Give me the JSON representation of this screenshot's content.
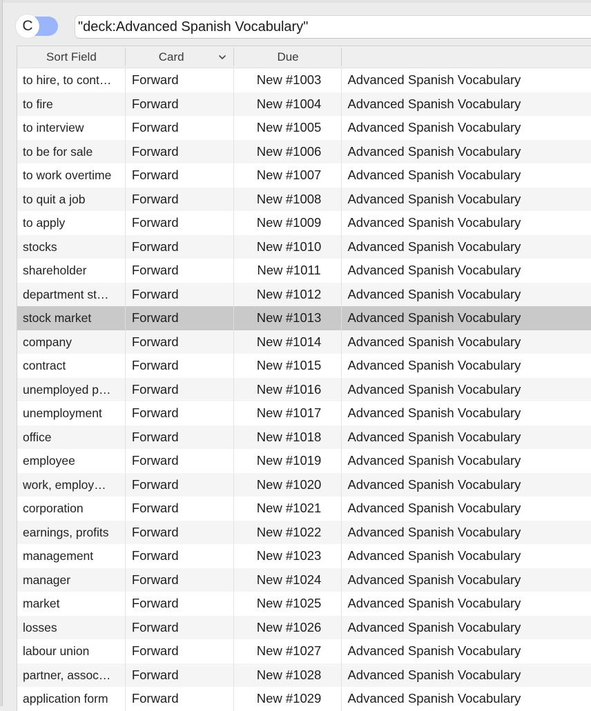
{
  "search": {
    "toggle_label": "C",
    "query": "\"deck:Advanced Spanish Vocabulary\""
  },
  "table": {
    "columns": [
      {
        "label": "Sort Field"
      },
      {
        "label": "Card"
      },
      {
        "label": "Due"
      },
      {
        "label": ""
      }
    ],
    "selected_index": 10,
    "rows": [
      {
        "sort_field": "to hire, to cont…",
        "card": "Forward",
        "due": "New #1003",
        "deck": "Advanced Spanish Vocabulary"
      },
      {
        "sort_field": "to fire",
        "card": "Forward",
        "due": "New #1004",
        "deck": "Advanced Spanish Vocabulary"
      },
      {
        "sort_field": "to interview",
        "card": "Forward",
        "due": "New #1005",
        "deck": "Advanced Spanish Vocabulary"
      },
      {
        "sort_field": "to be for sale",
        "card": "Forward",
        "due": "New #1006",
        "deck": "Advanced Spanish Vocabulary"
      },
      {
        "sort_field": "to work overtime",
        "card": "Forward",
        "due": "New #1007",
        "deck": "Advanced Spanish Vocabulary"
      },
      {
        "sort_field": "to quit a job",
        "card": "Forward",
        "due": "New #1008",
        "deck": "Advanced Spanish Vocabulary"
      },
      {
        "sort_field": "to apply",
        "card": "Forward",
        "due": "New #1009",
        "deck": "Advanced Spanish Vocabulary"
      },
      {
        "sort_field": "stocks",
        "card": "Forward",
        "due": "New #1010",
        "deck": "Advanced Spanish Vocabulary"
      },
      {
        "sort_field": "shareholder",
        "card": "Forward",
        "due": "New #1011",
        "deck": "Advanced Spanish Vocabulary"
      },
      {
        "sort_field": "department st…",
        "card": "Forward",
        "due": "New #1012",
        "deck": "Advanced Spanish Vocabulary"
      },
      {
        "sort_field": "stock market",
        "card": "Forward",
        "due": "New #1013",
        "deck": "Advanced Spanish Vocabulary"
      },
      {
        "sort_field": "company",
        "card": "Forward",
        "due": "New #1014",
        "deck": "Advanced Spanish Vocabulary"
      },
      {
        "sort_field": "contract",
        "card": "Forward",
        "due": "New #1015",
        "deck": "Advanced Spanish Vocabulary"
      },
      {
        "sort_field": "unemployed p…",
        "card": "Forward",
        "due": "New #1016",
        "deck": "Advanced Spanish Vocabulary"
      },
      {
        "sort_field": "unemployment",
        "card": "Forward",
        "due": "New #1017",
        "deck": "Advanced Spanish Vocabulary"
      },
      {
        "sort_field": "office",
        "card": "Forward",
        "due": "New #1018",
        "deck": "Advanced Spanish Vocabulary"
      },
      {
        "sort_field": "employee",
        "card": "Forward",
        "due": "New #1019",
        "deck": "Advanced Spanish Vocabulary"
      },
      {
        "sort_field": "work, employ…",
        "card": "Forward",
        "due": "New #1020",
        "deck": "Advanced Spanish Vocabulary"
      },
      {
        "sort_field": "corporation",
        "card": "Forward",
        "due": "New #1021",
        "deck": "Advanced Spanish Vocabulary"
      },
      {
        "sort_field": "earnings, profits",
        "card": "Forward",
        "due": "New #1022",
        "deck": "Advanced Spanish Vocabulary"
      },
      {
        "sort_field": "management",
        "card": "Forward",
        "due": "New #1023",
        "deck": "Advanced Spanish Vocabulary"
      },
      {
        "sort_field": "manager",
        "card": "Forward",
        "due": "New #1024",
        "deck": "Advanced Spanish Vocabulary"
      },
      {
        "sort_field": "market",
        "card": "Forward",
        "due": "New #1025",
        "deck": "Advanced Spanish Vocabulary"
      },
      {
        "sort_field": "losses",
        "card": "Forward",
        "due": "New #1026",
        "deck": "Advanced Spanish Vocabulary"
      },
      {
        "sort_field": "labour union",
        "card": "Forward",
        "due": "New #1027",
        "deck": "Advanced Spanish Vocabulary"
      },
      {
        "sort_field": "partner, assoc…",
        "card": "Forward",
        "due": "New #1028",
        "deck": "Advanced Spanish Vocabulary"
      },
      {
        "sort_field": "application form",
        "card": "Forward",
        "due": "New #1029",
        "deck": "Advanced Spanish Vocabulary"
      }
    ]
  }
}
